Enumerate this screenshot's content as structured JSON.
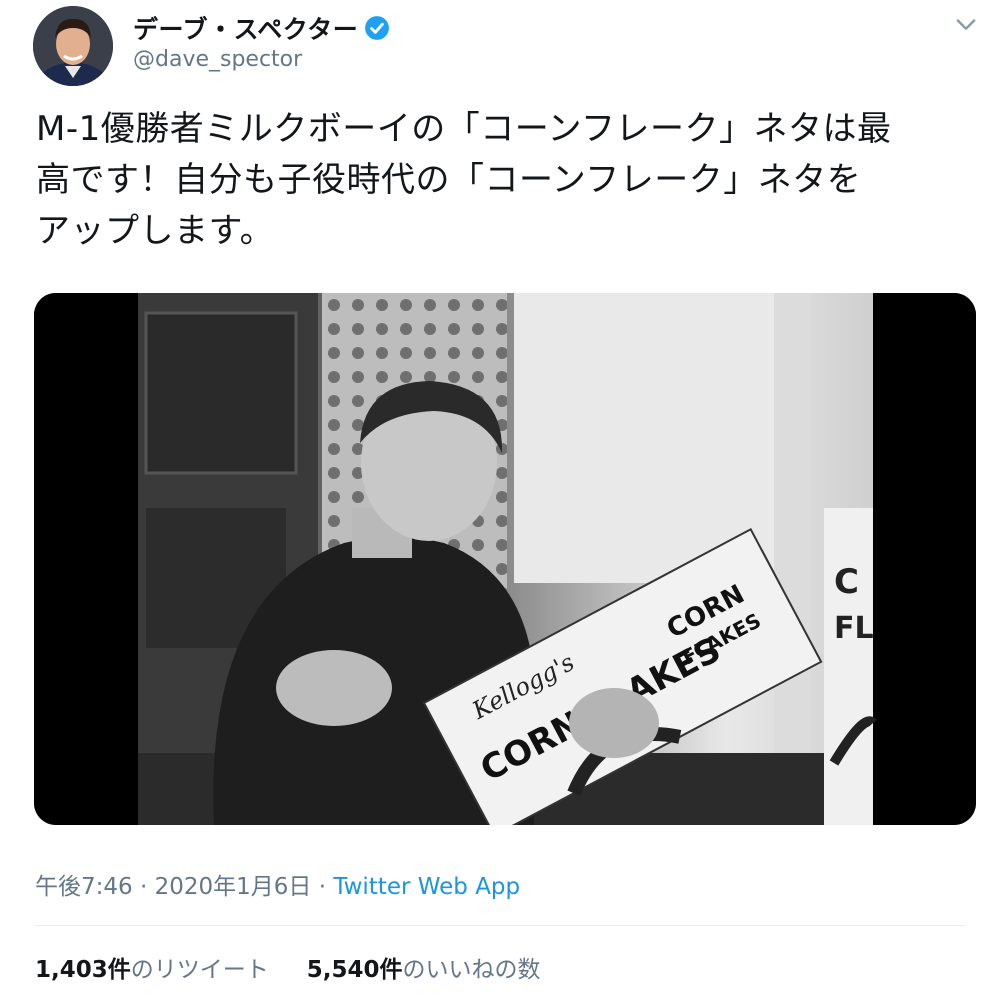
{
  "user": {
    "display_name": "デーブ・スペクター",
    "handle": "@dave_spector",
    "verified_badge": "verified-badge-icon"
  },
  "tweet": {
    "text": "M-1優勝者ミルクボーイの「コーンフレーク」ネタは最\n高です！自分も子役時代の「コーンフレーク」ネタを\nアップします。"
  },
  "media": {
    "box_text_1": "Kellogg's",
    "box_text_2": "CORN FLAKES",
    "box_text_3": "CORN",
    "box_text_4": "FLAKES",
    "side_box_text": "C\nFL"
  },
  "meta": {
    "time": "午後7:46",
    "sep1": " · ",
    "date": "2020年1月6日",
    "sep2": " · ",
    "source": "Twitter Web App"
  },
  "stats": {
    "retweets_count": "1,403件",
    "retweets_label": "のリツイート",
    "likes_count": "5,540件",
    "likes_label": "のいいねの数"
  },
  "colors": {
    "accent": "#1da1f2",
    "link": "#1b95e0",
    "secondary_text": "#657786"
  }
}
